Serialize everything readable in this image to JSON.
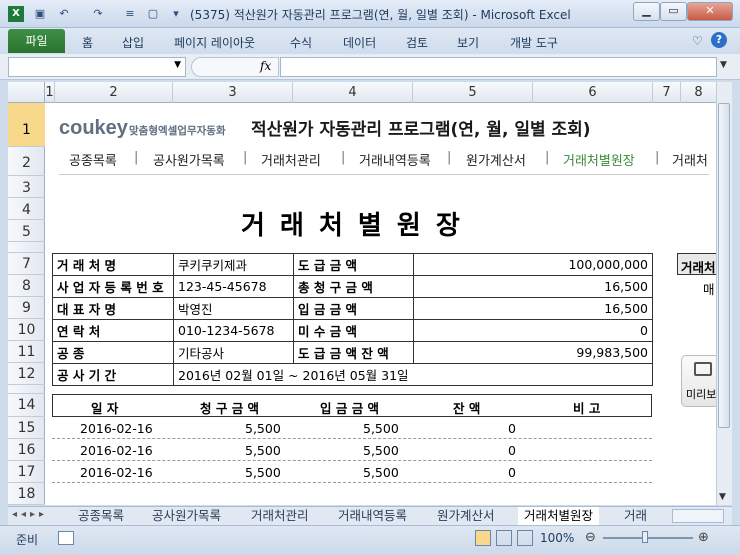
{
  "window": {
    "title": "(5375) 적산원가 자동관리 프로그램(연, 월, 일별 조회)  -  Microsoft Excel"
  },
  "ribbon": {
    "file": "파일",
    "tabs": [
      "홈",
      "삽입",
      "페이지 레이아웃",
      "수식",
      "데이터",
      "검토",
      "보기",
      "개발 도구"
    ]
  },
  "formula_bar": {
    "name_box": "",
    "fx": "fx",
    "content": ""
  },
  "columns": [
    "1",
    "2",
    "3",
    "4",
    "5",
    "6",
    "7",
    "8"
  ],
  "rows": [
    "1",
    "2",
    "3",
    "4",
    "5",
    "6",
    "7",
    "8",
    "9",
    "10",
    "11",
    "12",
    "14",
    "15",
    "16",
    "17",
    "18"
  ],
  "sheet": {
    "logo": {
      "text": "coukey",
      "tagline": "맞춤형엑셀업무자동화"
    },
    "title": "적산원가 자동관리 프로그램(연, 월, 일별 조회)",
    "menu": [
      "공종목록",
      "공사원가목록",
      "거래처관리",
      "거래내역등록",
      "원가계산서",
      "거래처별원장",
      "거래처"
    ],
    "heading": "거 래 처 별 원 장",
    "info": {
      "r7": {
        "l1": "거    래    처    명",
        "v1": "쿠키쿠키제과",
        "l2": "도    급    금    액",
        "v2": "100,000,000"
      },
      "r8": {
        "l1": "사 업 자 등 록 번 호",
        "v1": "123-45-45678",
        "l2": "총  청  구  금  액",
        "v2": "16,500"
      },
      "r9": {
        "l1": "대     표     자     명",
        "v1": "박영진",
        "l2": "입    금    금    액",
        "v2": "16,500"
      },
      "r10": {
        "l1": "연          락          처",
        "v1": "010-1234-5678",
        "l2": "미    수    금    액",
        "v2": "0"
      },
      "r11": {
        "l1": "공                      종",
        "v1": "기타공사",
        "l2": "도 급 금 액 잔 액",
        "v2": "99,983,500"
      },
      "r12": {
        "l1": "공    사    기    간",
        "v1": "2016년 02월 01일  ~  2016년 05월 31일"
      }
    },
    "side_panel": {
      "header": "거래처",
      "value": "매"
    },
    "side_button": "미리보",
    "table_headers": [
      "일    자",
      "청 구 금 액",
      "입 금 금 액",
      "잔    액",
      "비    고"
    ],
    "rows_data": [
      {
        "date": "2016-02-16",
        "charge": "5,500",
        "deposit": "5,500",
        "balance": "0"
      },
      {
        "date": "2016-02-16",
        "charge": "5,500",
        "deposit": "5,500",
        "balance": "0"
      },
      {
        "date": "2016-02-16",
        "charge": "5,500",
        "deposit": "5,500",
        "balance": "0"
      }
    ]
  },
  "sheet_tabs": [
    "공종목록",
    "공사원가목록",
    "거래처관리",
    "거래내역등록",
    "원가계산서",
    "거래처별원장",
    "거래"
  ],
  "status": {
    "ready": "준비",
    "zoom": "100%"
  },
  "colors": {
    "accent_green": "#2a7530",
    "menu_active": "#3a8a3a",
    "row_selected": "#f8d98c"
  }
}
